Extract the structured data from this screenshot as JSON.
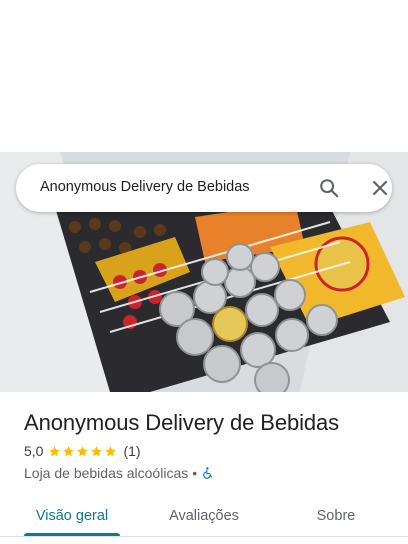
{
  "search": {
    "query": "Anonymous Delivery de Bebidas"
  },
  "hero": {
    "photo_subject": "chest freezer with beer cans and bottles"
  },
  "place": {
    "title": "Anonymous Delivery de Bebidas",
    "rating": "5,0",
    "stars": 5,
    "review_count": "(1)",
    "category": "Loja de bebidas alcoólicas",
    "separator": "•",
    "accessibility_icon": "wheelchair-icon"
  },
  "tabs": [
    {
      "label": "Visão geral",
      "active": true
    },
    {
      "label": "Avaliações",
      "active": false
    },
    {
      "label": "Sobre",
      "active": false
    }
  ],
  "colors": {
    "accent": "#0d7a8a",
    "star": "#fbbc04",
    "accessibility": "#1a73e8"
  }
}
